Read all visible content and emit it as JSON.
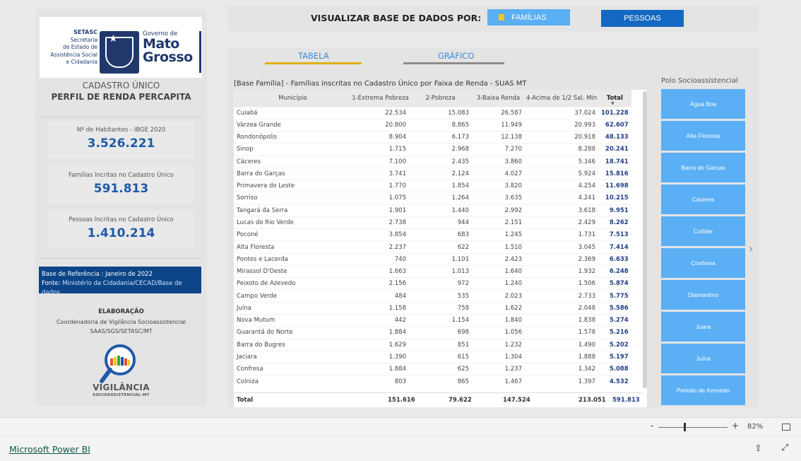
{
  "logo": {
    "setasc_lines": [
      "SETASC",
      "Secretaria",
      "de Estado de",
      "Assistência Social",
      "e Cidadania"
    ],
    "gov_line": "Governo de",
    "mato": "Mato",
    "grosso": "Grosso"
  },
  "left": {
    "title": "CADASTRO ÚNICO",
    "subtitle": "PERFIL DE RENDA PERCAPITA",
    "stats": [
      {
        "label": "Nº de Habitantes - IBGE 2020",
        "value": "3.526.221"
      },
      {
        "label": "Famílias Incritas no Cadastro Único",
        "value": "591.813"
      },
      {
        "label": "Pessoas Incritas no Cadastro Único",
        "value": "1.410.214"
      }
    ],
    "ref_line": "Base de Referência :  Janeiro de 2022",
    "fonte_label": "Fonte: ",
    "fonte_link": "Ministério da Cidadania/CECAD/Base de dados",
    "elab_title": "ELABORAÇÃO",
    "elab_line1": "Coordenadoria de Vigilância Socioassistencial",
    "elab_line2": "SAAS/SGS/SETASC/MT",
    "vig_name": "VIGILÂNCIA",
    "vig_sub": "SOCIOASSISTENCIAL-MT"
  },
  "selector": {
    "label": "VISUALIZAR BASE DE DADOS POR:",
    "btn_familias": "FAMÍLIAS",
    "btn_pessoas": "PESSOAS"
  },
  "tabs": {
    "tabela": "TABELA",
    "grafico": "GRÁFICO"
  },
  "table": {
    "title": "[Base Família] - Famílias inscritas no Cadastro Único por Faixa de Renda - SUAS MT",
    "headers": [
      "Município",
      "1-Extrema Pobreza",
      "2-Pobreza",
      "3-Baixa Renda",
      "4-Acima de 1/2 Sal. Min",
      "Total"
    ],
    "rows": [
      [
        "Cuiabá",
        "22.534",
        "15.083",
        "26.587",
        "37.024",
        "101.228"
      ],
      [
        "Várzea Grande",
        "20.800",
        "8.865",
        "11.949",
        "20.993",
        "62.607"
      ],
      [
        "Rondonópolis",
        "8.904",
        "6.173",
        "12.138",
        "20.918",
        "48.133"
      ],
      [
        "Sinop",
        "1.715",
        "2.968",
        "7.270",
        "8.288",
        "20.241"
      ],
      [
        "Cáceres",
        "7.100",
        "2.435",
        "3.860",
        "5.346",
        "18.741"
      ],
      [
        "Barra do Garças",
        "3.741",
        "2.124",
        "4.027",
        "5.924",
        "15.816"
      ],
      [
        "Primavera do Leste",
        "1.770",
        "1.854",
        "3.820",
        "4.254",
        "11.698"
      ],
      [
        "Sorriso",
        "1.075",
        "1.264",
        "3.635",
        "4.241",
        "10.215"
      ],
      [
        "Tangará da Serra",
        "1.901",
        "1.440",
        "2.992",
        "3.618",
        "9.951"
      ],
      [
        "Lucas do Rio Verde",
        "2.738",
        "944",
        "2.151",
        "2.429",
        "8.262"
      ],
      [
        "Poconé",
        "3.854",
        "683",
        "1.245",
        "1.731",
        "7.513"
      ],
      [
        "Alta Floresta",
        "2.237",
        "622",
        "1.510",
        "3.045",
        "7.414"
      ],
      [
        "Pontes e Lacerda",
        "740",
        "1.101",
        "2.423",
        "2.369",
        "6.633"
      ],
      [
        "Mirassol D'Oeste",
        "1.663",
        "1.013",
        "1.640",
        "1.932",
        "6.248"
      ],
      [
        "Peixoto de Azevedo",
        "2.156",
        "972",
        "1.240",
        "1.506",
        "5.874"
      ],
      [
        "Campo Verde",
        "484",
        "535",
        "2.023",
        "2.733",
        "5.775"
      ],
      [
        "Juína",
        "1.158",
        "758",
        "1.622",
        "2.048",
        "5.586"
      ],
      [
        "Nova Mutum",
        "442",
        "1.154",
        "1.840",
        "1.838",
        "5.274"
      ],
      [
        "Guarantã do Norte",
        "1.884",
        "698",
        "1.056",
        "1.578",
        "5.216"
      ],
      [
        "Barra do Bugres",
        "1.629",
        "851",
        "1.232",
        "1.490",
        "5.202"
      ],
      [
        "Jaciara",
        "1.390",
        "615",
        "1.304",
        "1.888",
        "5.197"
      ],
      [
        "Confresa",
        "1.884",
        "625",
        "1.237",
        "1.342",
        "5.088"
      ],
      [
        "Colniza",
        "803",
        "865",
        "1.467",
        "1.397",
        "4.532"
      ]
    ],
    "total": [
      "Total",
      "151.616",
      "79.622",
      "147.524",
      "213.051",
      "591.813"
    ]
  },
  "polo": {
    "title": "Polo Socioassistencial",
    "items": [
      "Água Boa",
      "Alta Floresta",
      "Barra do Garças",
      "Cáceres",
      "Colíder",
      "Confresa",
      "Diamantino",
      "Juara",
      "Juína",
      "Peixoto de Azevedo"
    ]
  },
  "zoom": {
    "minus": "-",
    "plus": "+",
    "value": "82%",
    "level": 0.37
  },
  "footer": {
    "link": "Microsoft Power BI"
  },
  "icons": {
    "share": "share-icon",
    "expand": "expand-icon",
    "fit": "fit-to-page-icon",
    "next": "chevron-right-icon",
    "sort": "sort-desc-icon"
  },
  "colors": {
    "accent": "#1e5aa8",
    "button_light": "#5aaff5",
    "button_dark": "#1368c1",
    "ref_bg": "#0c4587",
    "tab_active": "#e0b017",
    "total_text": "#1e3f85"
  }
}
